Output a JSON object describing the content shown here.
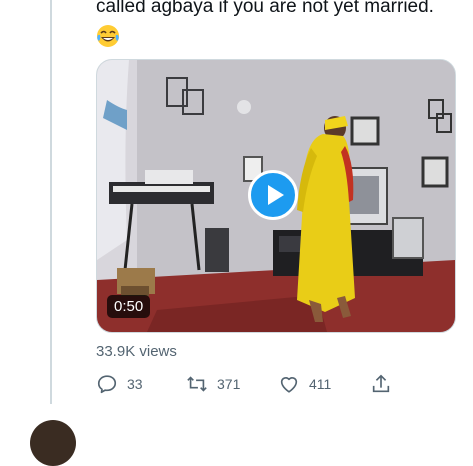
{
  "tweet": {
    "text": "called agbaya if you are not yet married.",
    "emoji": "😂"
  },
  "video": {
    "duration": "0:50",
    "play_icon": "play-icon"
  },
  "stats": {
    "views": "33.9K views"
  },
  "actions": {
    "reply_count": "33",
    "retweet_count": "371",
    "like_count": "411"
  },
  "colors": {
    "accent": "#1d9bf0",
    "muted": "#536471",
    "divider": "#cfd9de"
  }
}
